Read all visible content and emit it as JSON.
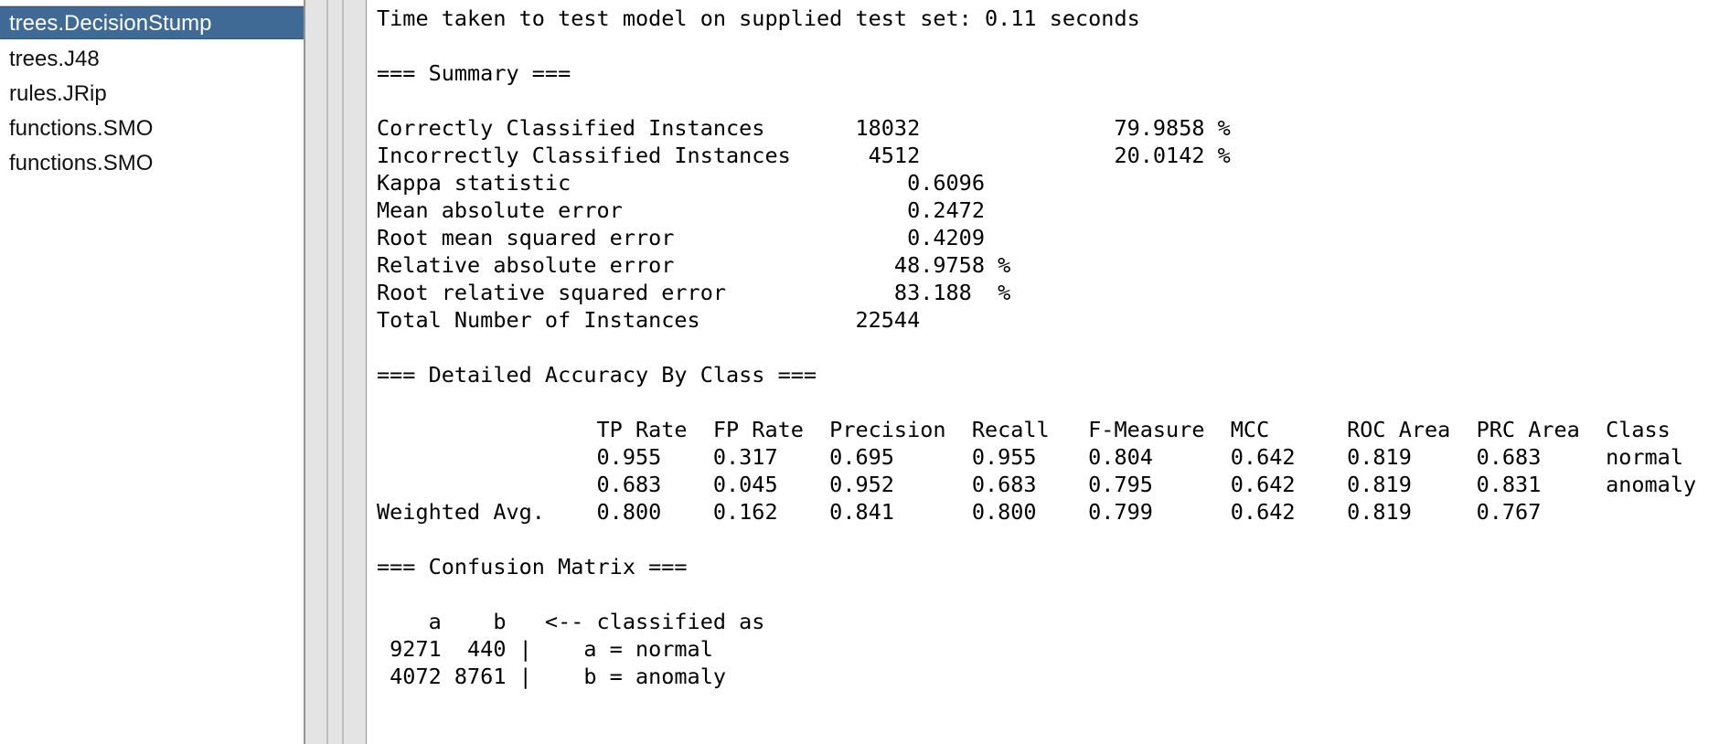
{
  "result_list": {
    "items": [
      {
        "label": "trees.DecisionStump",
        "selected": true
      },
      {
        "label": "trees.J48",
        "selected": false
      },
      {
        "label": "rules.JRip",
        "selected": false
      },
      {
        "label": "functions.SMO",
        "selected": false
      },
      {
        "label": "functions.SMO",
        "selected": false
      }
    ]
  },
  "output": {
    "lines": [
      "Time taken to test model on supplied test set: 0.11 seconds",
      "",
      "=== Summary ===",
      "",
      "Correctly Classified Instances       18032               79.9858 %",
      "Incorrectly Classified Instances      4512               20.0142 %",
      "Kappa statistic                          0.6096",
      "Mean absolute error                      0.2472",
      "Root mean squared error                  0.4209",
      "Relative absolute error                 48.9758 %",
      "Root relative squared error             83.188  %",
      "Total Number of Instances            22544",
      "",
      "=== Detailed Accuracy By Class ===",
      "",
      "                 TP Rate  FP Rate  Precision  Recall   F-Measure  MCC      ROC Area  PRC Area  Class",
      "                 0.955    0.317    0.695      0.955    0.804      0.642    0.819     0.683     normal",
      "                 0.683    0.045    0.952      0.683    0.795      0.642    0.819     0.831     anomaly",
      "Weighted Avg.    0.800    0.162    0.841      0.800    0.799      0.642    0.819     0.767",
      "",
      "=== Confusion Matrix ===",
      "",
      "    a    b   <-- classified as",
      " 9271  440 |    a = normal",
      " 4072 8761 |    b = anomaly"
    ]
  }
}
